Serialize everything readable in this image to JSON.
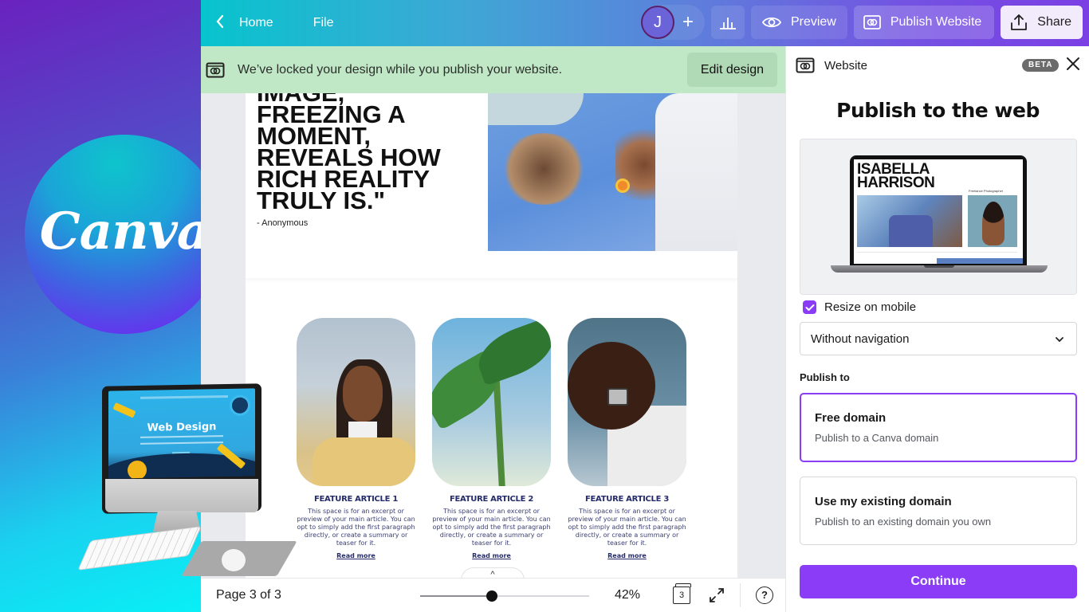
{
  "promo": {
    "brand_logo_text": "Canva",
    "illustration_screen_title": "Web Design"
  },
  "topbar": {
    "back_label": "Home",
    "file_label": "File",
    "avatar_initial": "J",
    "add_collaborator_icon": "plus-icon",
    "insights_icon": "bar-chart-icon",
    "preview_label": "Preview",
    "publish_label": "Publish Website",
    "share_label": "Share"
  },
  "banner": {
    "message": "We’ve locked your design while you publish your website.",
    "edit_label": "Edit design",
    "background_color": "#c1e8c6"
  },
  "canvas": {
    "quote_text": "IMAGE,\nFREEZING A\nMOMENT,\nREVEALS HOW\nRICH REALITY\nTRULY IS.\"",
    "quote_author": "- Anonymous",
    "articles": [
      {
        "title": "FEATURE ARTICLE 1",
        "body": "This space is for an excerpt or preview of your main article. You can opt to simply add the first paragraph directly, or create a summary or teaser for it.",
        "link": "Read more"
      },
      {
        "title": "FEATURE ARTICLE 2",
        "body": "This space is for an excerpt or preview of your main article. You can opt to simply add the first paragraph directly, or create a summary or teaser for it.",
        "link": "Read more"
      },
      {
        "title": "FEATURE ARTICLE 3",
        "body": "This space is for an excerpt or preview of your main article. You can opt to simply add the first paragraph directly, or create a summary or teaser for it.",
        "link": "Read more"
      }
    ],
    "collapse_glyph": "^"
  },
  "bottombar": {
    "page_indicator": "Page 3 of 3",
    "zoom_value": 0.42,
    "zoom_label": "42%",
    "page_count_badge": "3",
    "help_glyph": "?"
  },
  "panel": {
    "header_title": "Website",
    "badge": "BETA",
    "title": "Publish to the web",
    "preview": {
      "site_name": "ISABELLA\nHARRISON",
      "site_tagline": "Freelance Photographer"
    },
    "resize_on_mobile": {
      "label": "Resize on mobile",
      "checked": true
    },
    "navigation_select": {
      "value": "Without navigation"
    },
    "publish_to_label": "Publish to",
    "domain_options": [
      {
        "title": "Free domain",
        "subtitle": "Publish to a Canva domain",
        "selected": true
      },
      {
        "title": "Use my existing domain",
        "subtitle": "Publish to an existing domain you own",
        "selected": false
      }
    ],
    "continue_label": "Continue",
    "accent_color": "#8b3cf7"
  }
}
